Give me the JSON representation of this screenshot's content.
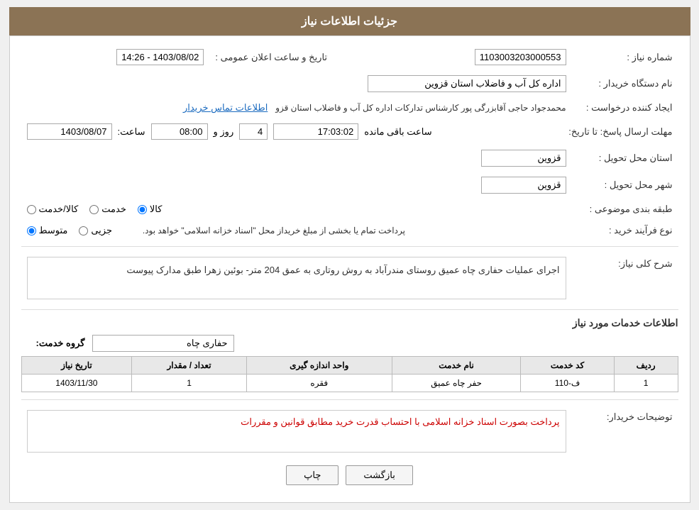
{
  "header": {
    "title": "جزئیات اطلاعات نیاز"
  },
  "fields": {
    "need_number_label": "شماره نیاز :",
    "need_number_value": "1103003203000553",
    "buyer_org_label": "نام دستگاه خریدار :",
    "buyer_org_value": "اداره کل آب و فاضلاب استان قزوین",
    "requester_label": "ایجاد کننده درخواست :",
    "requester_value": "محمدجواد حاجی آقابزرگی پور کارشناس تدارکات اداره کل آب و فاضلاب استان قزو",
    "requester_link": "اطلاعات تماس خریدار",
    "response_date_label": "مهلت ارسال پاسخ: تا تاریخ:",
    "date_value": "1403/08/07",
    "time_label": "ساعت:",
    "time_value": "08:00",
    "days_label": "روز و",
    "days_value": "4",
    "remaining_label": "ساعت باقی مانده",
    "remaining_time": "17:03:02",
    "announce_date_label": "تاریخ و ساعت اعلان عمومی :",
    "announce_date_value": "1403/08/02 - 14:26",
    "province_delivery_label": "استان محل تحویل :",
    "province_delivery_value": "قزوین",
    "city_delivery_label": "شهر محل تحویل :",
    "city_delivery_value": "قزوین",
    "category_label": "طبقه بندی موضوعی :",
    "category_options": [
      "کالا",
      "خدمت",
      "کالا/خدمت"
    ],
    "category_selected": "کالا",
    "purchase_type_label": "نوع فرآیند خرید :",
    "purchase_type_options": [
      "جزیی",
      "متوسط"
    ],
    "purchase_type_selected": "متوسط",
    "purchase_note": "پرداخت تمام یا بخشی از مبلغ خریداز محل \"اسناد خزانه اسلامی\" خواهد بود.",
    "general_desc_label": "شرح کلی نیاز:",
    "general_desc_value": "اجرای عملیات حفاری چاه عمیق روستای مندرآباد به روش روتاری به عمق 204 متر-  بوئین زهرا طبق مدارک پیوست",
    "services_section_title": "اطلاعات خدمات مورد نیاز",
    "group_service_label": "گروه خدمت:",
    "group_service_value": "حفاری چاه",
    "table_headers": [
      "ردیف",
      "کد خدمت",
      "نام خدمت",
      "واحد اندازه گیری",
      "تعداد / مقدار",
      "تاریخ نیاز"
    ],
    "table_rows": [
      {
        "row": "1",
        "code": "ف-110",
        "name": "حفر چاه عمیق",
        "unit": "فقره",
        "qty": "1",
        "date": "1403/11/30"
      }
    ],
    "buyer_notes_label": "توضیحات خریدار:",
    "buyer_notes_value": "پرداخت بصورت اسناد خزانه اسلامی با احتساب قدرت خرید مطابق قوانین و مقررات"
  },
  "buttons": {
    "print_label": "چاپ",
    "back_label": "بازگشت"
  }
}
